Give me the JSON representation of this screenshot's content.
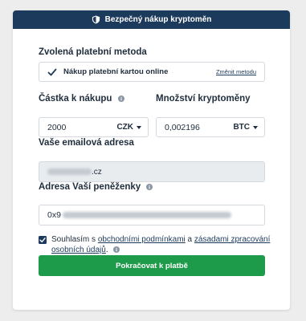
{
  "header": {
    "title": "Bezpečný nákup kryptoměn",
    "icon": "shield-icon"
  },
  "payment": {
    "label": "Zvolená platební metoda",
    "method": "Nákup platební kartou online",
    "change_link": "Změnit metodu",
    "checked": true
  },
  "amount": {
    "label": "Částka k nákupu",
    "value": "2000",
    "currency": "CZK"
  },
  "quantity": {
    "label": "Množství kryptoměny",
    "value": "0,002196",
    "currency": "BTC"
  },
  "email": {
    "label": "Vaše emailová adresa",
    "value_suffix": ".cz"
  },
  "wallet": {
    "label": "Adresa Vaší peněženky",
    "value_prefix": "0x9"
  },
  "consent": {
    "text_before": "Souhlasím s ",
    "terms_link": "obchodními podmínkami",
    "text_middle": " a ",
    "privacy_link": "zásadami zpracování osobních údajů",
    "text_after": ".",
    "checked": true
  },
  "submit": {
    "label": "Pokračovat k platbě"
  },
  "colors": {
    "header_bg": "#1c3a5c",
    "button_bg": "#1e9b4a",
    "check": "#1c3a5c"
  }
}
